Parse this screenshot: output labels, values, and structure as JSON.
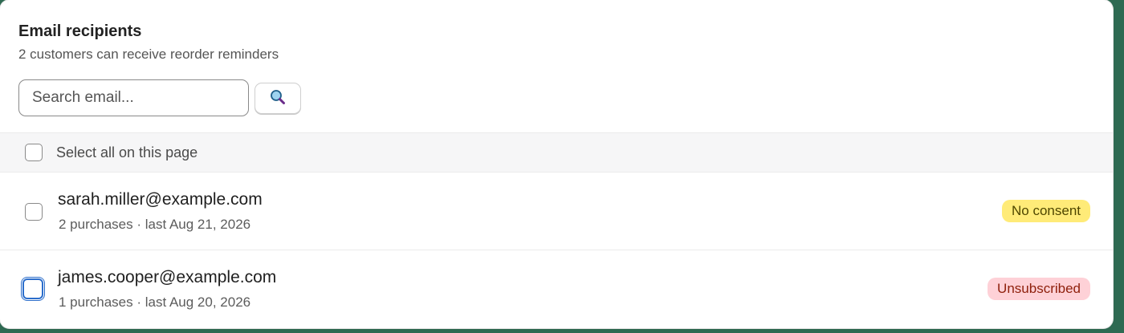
{
  "card": {
    "title": "Email recipients",
    "subtitle": "2 customers can receive reorder reminders"
  },
  "search": {
    "placeholder": "Search email...",
    "value": "",
    "button_icon": "search-icon"
  },
  "select_all": {
    "label": "Select all on this page",
    "checked": false
  },
  "recipients": [
    {
      "email": "sarah.miller@example.com",
      "meta": "2 purchases · last Aug 21, 2026",
      "status": "No consent",
      "status_tone": "warning",
      "checked": false
    },
    {
      "email": "james.cooper@example.com",
      "meta": "1 purchases · last Aug 20, 2026",
      "status": "Unsubscribed",
      "status_tone": "critical",
      "checked": false,
      "focused": true
    }
  ],
  "colors": {
    "warning_badge_bg": "#ffeb78",
    "critical_badge_bg": "#fed1d7",
    "focus_ring": "#2c6ecb"
  }
}
